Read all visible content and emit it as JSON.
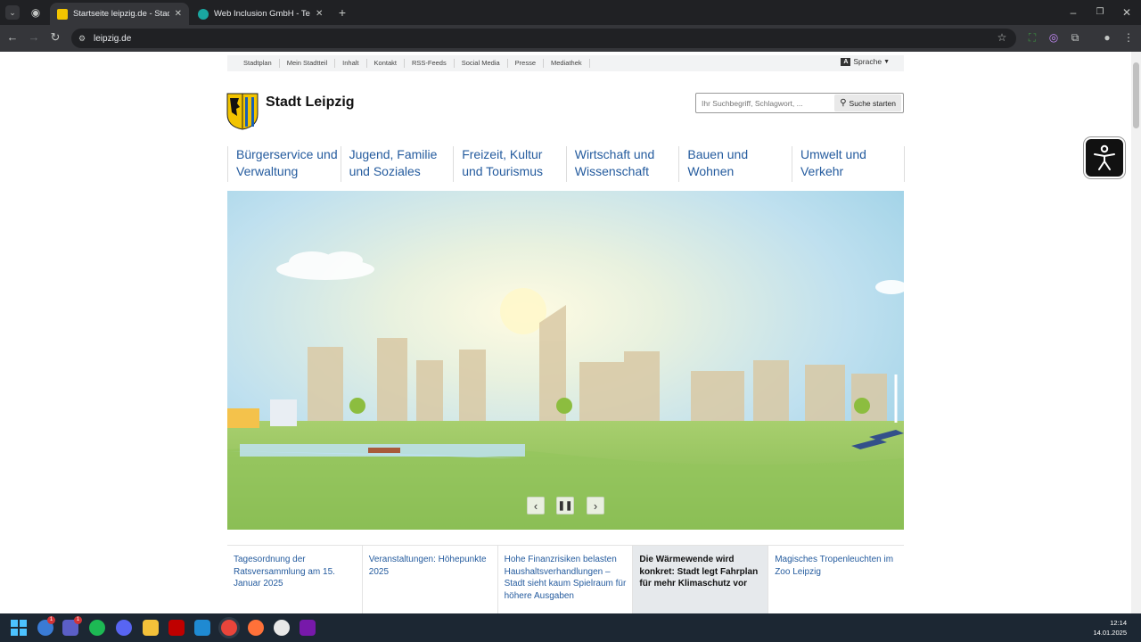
{
  "browser": {
    "tabs": [
      {
        "title": "Startseite leipzig.de - Stadt Leipzig",
        "active": true
      },
      {
        "title": "Web Inclusion GmbH - Technical",
        "active": false
      }
    ],
    "address": "leipzig.de"
  },
  "site": {
    "topnav": [
      "Stadtplan",
      "Mein Stadtteil",
      "Inhalt",
      "Kontakt",
      "RSS-Feeds",
      "Social Media",
      "Presse",
      "Mediathek"
    ],
    "language_badge": "A",
    "language_label": "Sprache",
    "logo_text": "Stadt Leipzig",
    "search_placeholder": "Ihr Suchbegriff, Schlagwort, ...",
    "search_button": "Suche starten",
    "main_nav": [
      {
        "line1": "Bürgerservice und",
        "line2": "Verwaltung"
      },
      {
        "line1": "Jugend, Familie",
        "line2": "und Soziales"
      },
      {
        "line1": "Freizeit, Kultur",
        "line2": "und Tourismus"
      },
      {
        "line1": "Wirtschaft und",
        "line2": "Wissenschaft"
      },
      {
        "line1": "Bauen und",
        "line2": "Wohnen"
      },
      {
        "line1": "Umwelt und",
        "line2": "Verkehr"
      }
    ],
    "news": [
      "Tagesordnung der Ratsversammlung am 15. Januar 2025",
      "Veranstaltungen: Höhepunkte 2025",
      "Hohe Finanzrisiken belasten Haushaltsverhandlungen – Stadt sieht kaum Spielraum für höhere Ausgaben",
      "Die Wärmewende wird konkret: Stadt legt Fahrplan für mehr Klimaschutz vor",
      "Magisches Tropenleuchten im Zoo Leipzig"
    ]
  },
  "taskbar": {
    "time": "12:14",
    "date": "14.01.2025",
    "badge_1": "1",
    "badge_2": "1"
  },
  "colors": {
    "link": "#245b9e",
    "chrome_dark": "#202124",
    "taskbar": "#1c2733"
  }
}
